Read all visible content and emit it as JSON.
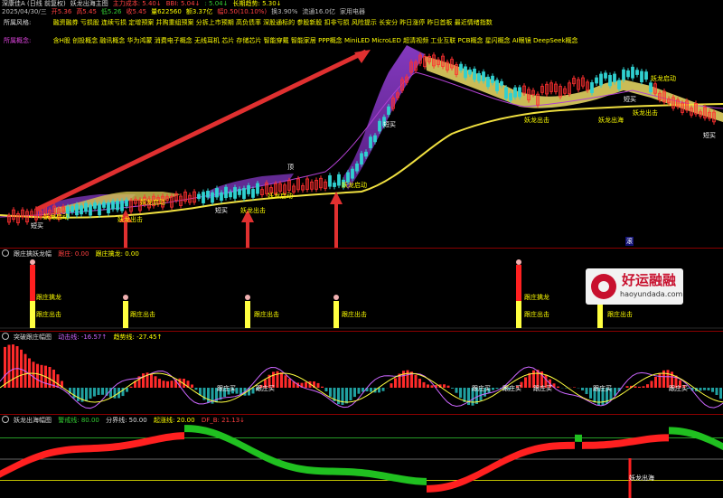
{
  "header": {
    "row1": [
      {
        "text": "深康佳A (日线 前复权)",
        "color": "#dddddd"
      },
      {
        "text": "妖龙出海主图",
        "color": "#dddddd"
      },
      {
        "text": "主力成本: 5.40↓",
        "color": "#ff4040"
      },
      {
        "text": "BBI: 5.04↓",
        "color": "#ff4040"
      },
      {
        "text": ": 5.04↓",
        "color": "#33cc33"
      },
      {
        "text": "长期趋势: 5.30↓",
        "color": "#ffff00"
      }
    ],
    "row2": [
      {
        "text": "2025/04/30/三",
        "color": "#bbbbbb"
      },
      {
        "text": "开5.36",
        "color": "#ff4040"
      },
      {
        "text": "高5.45",
        "color": "#ff4040"
      },
      {
        "text": "低5.26",
        "color": "#33cc33"
      },
      {
        "text": "收5.45",
        "color": "#ff4040"
      },
      {
        "text": "量622560",
        "color": "#ffff00"
      },
      {
        "text": "额3.37亿",
        "color": "#ffff00"
      },
      {
        "text": "幅0.50(10.10%)",
        "color": "#ff4040"
      },
      {
        "text": "换3.90%",
        "color": "#bbbbbb"
      },
      {
        "text": "流通16.0亿",
        "color": "#bbbbbb"
      },
      {
        "text": "家用电器",
        "color": "#bbbbbb"
      }
    ],
    "style_label": "所属风格:",
    "style_text": "融资融券 亏损股 连续亏损 定增预案 并购重组预案 分拆上市预期 高负债率 深股通标的 参股新股 扣非亏损 风险提示 长安分 昨日涨停 昨日首板 最近情绪指数",
    "concept_label": "所属概念:",
    "concept_text": "含H股 创投概念 融讯概念 华为鸿蒙 消费电子概念 无线耳机 芯片 存储芯片 智能穿戴 智能家居 PPP概念 MiniLED MicroLED 超清视频 工业互联 PCB概念 星闪概念 AI眼镜 DeepSeek概念"
  },
  "main_chart": {
    "annotations": [
      {
        "text": "妖龙启动",
        "color": "#ffff00"
      },
      {
        "text": "妖龙启动",
        "color": "#ffff00"
      },
      {
        "text": "妖龙启动",
        "color": "#ffff00"
      },
      {
        "text": "妖龙启动",
        "color": "#ffff00"
      },
      {
        "text": "妖龙出击",
        "color": "#ffff00"
      },
      {
        "text": "妖龙出击",
        "color": "#ffff00"
      },
      {
        "text": "妖龙出击",
        "color": "#ffff00"
      },
      {
        "text": "妖龙出击",
        "color": "#ffff00"
      },
      {
        "text": "妖龙出海",
        "color": "#ffff00"
      },
      {
        "text": "妖龙启动",
        "color": "#ffff00"
      },
      {
        "text": "短买",
        "color": "#ffffff"
      },
      {
        "text": "短买",
        "color": "#ffffff"
      },
      {
        "text": "短买",
        "color": "#ffffff"
      },
      {
        "text": "短买",
        "color": "#ffffff"
      },
      {
        "text": "短买",
        "color": "#ffffff"
      },
      {
        "text": "顶",
        "color": "#ffffff"
      }
    ],
    "marker": "滚"
  },
  "panel2": {
    "title": "跟庄擒妖龙幅",
    "items": [
      {
        "text": "跟庄: 0.00",
        "color": "#ff4040"
      },
      {
        "text": "跟庄擒龙: 0.00",
        "color": "#ffff00"
      }
    ],
    "labels": [
      "跟庄出击",
      "跟庄出击",
      "跟庄出击",
      "跟庄出击",
      "跟庄出击",
      "跟庄出击"
    ],
    "label_catch": [
      "跟庄擒龙",
      "跟庄擒龙"
    ]
  },
  "panel3": {
    "title": "突破跟庄幅图",
    "items": [
      {
        "text": "动击线: -16.57↑",
        "color": "#cc66ff"
      },
      {
        "text": "趋势线: -27.45↑",
        "color": "#ffff00"
      }
    ],
    "labels": [
      "跟庄买",
      "跟庄买",
      "跟庄买",
      "跟庄买",
      "跟庄买",
      "跟庄买",
      "跟庄买"
    ]
  },
  "panel4": {
    "title": "妖龙出海幅图",
    "items": [
      {
        "text": "警戒线: 80.00",
        "color": "#33cc33"
      },
      {
        "text": "分界线: 50.00",
        "color": "#dddddd"
      },
      {
        "text": "起涨线: 20.00",
        "color": "#ffff00"
      },
      {
        "text": "DF_B: 21.13↓",
        "color": "#ff4040"
      }
    ],
    "labels": [
      "妖龙出海",
      "妖龙出海"
    ],
    "levels": [
      80,
      50,
      20
    ]
  },
  "watermark": {
    "title": "好运融融",
    "sub": "haoyundada.com"
  }
}
